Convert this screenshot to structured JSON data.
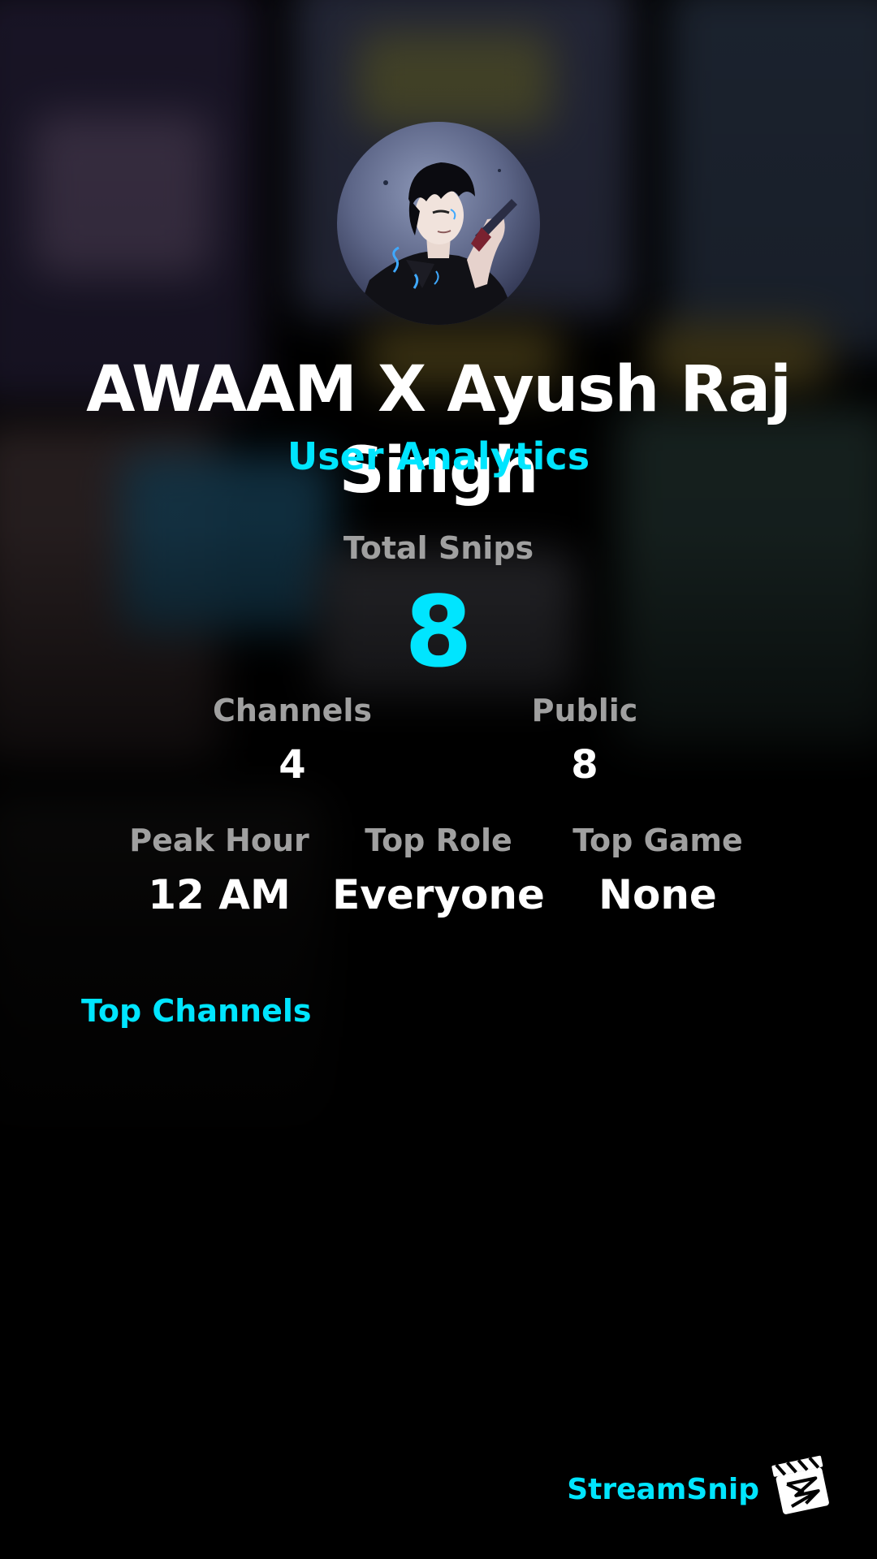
{
  "profile": {
    "name": "AWAAM X Ayush Raj Singh",
    "subtitle": "User Analytics"
  },
  "stats": {
    "total_label": "Total Snips",
    "total_value": "8",
    "channels_label": "Channels",
    "channels_value": "4",
    "public_label": "Public",
    "public_value": "8",
    "peak_label": "Peak Hour",
    "peak_value": "12 AM",
    "role_label": "Top Role",
    "role_value": "Everyone",
    "game_label": "Top Game",
    "game_value": "None"
  },
  "sections": {
    "top_channels": "Top Channels"
  },
  "brand": {
    "name": "StreamSnip"
  },
  "colors": {
    "accent": "#00e5ff",
    "background": "#000000",
    "label": "#a0a0a0",
    "text": "#ffffff"
  },
  "icons": {
    "avatar": "anime-character-avatar",
    "logo": "clapperboard-logo-icon"
  }
}
